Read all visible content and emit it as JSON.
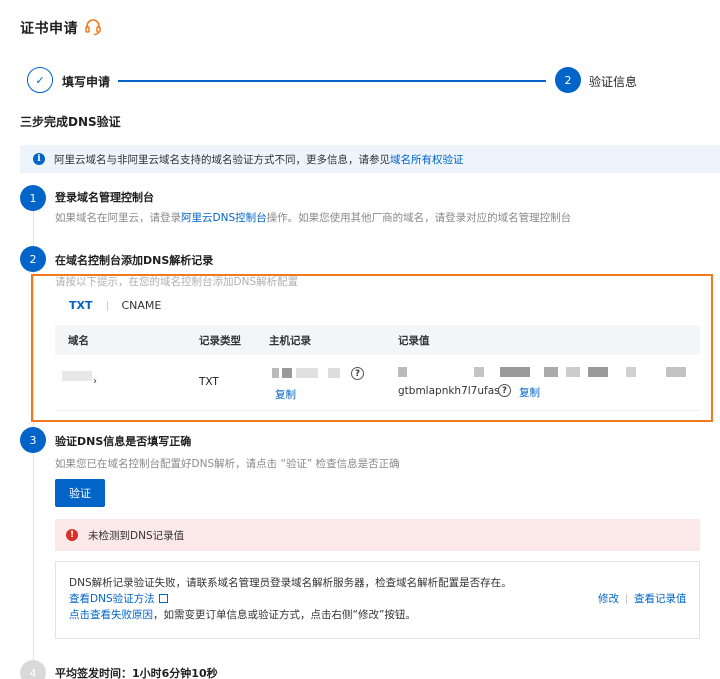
{
  "header": {
    "title": "证书申请"
  },
  "steps": [
    {
      "label": "填写申请",
      "status": "done",
      "mark": "✓"
    },
    {
      "label": "验证信息",
      "number": "2",
      "status": "current"
    }
  ],
  "section_title": "三步完成DNS验证",
  "info": {
    "icon_text": "i",
    "text": "阿里云域名与非阿里云域名支持的域名验证方式不同，更多信息，请参见",
    "link": "域名所有权验证"
  },
  "step1": {
    "number": "1",
    "title": "登录域名管理控制台",
    "desc_prefix": "如果域名在阿里云，请登录",
    "desc_link": "阿里云DNS控制台",
    "desc_suffix": "操作。如果您使用其他厂商的域名，请登录对应的域名管理控制台"
  },
  "step2": {
    "number": "2",
    "title": "在域名控制台添加DNS解析记录",
    "desc": "请按以下提示，在您的域名控制台添加DNS解析配置",
    "tabs": [
      "TXT",
      "CNAME"
    ],
    "columns": [
      "域名",
      "记录类型",
      "主机记录",
      "记录值"
    ],
    "row": {
      "domain": "›",
      "type": "TXT",
      "host_copy": "复制",
      "value_tail": "gtbmlapnkh7l7ufas",
      "value_copy": "复制",
      "help_mark": "?"
    }
  },
  "step3": {
    "number": "3",
    "title": "验证DNS信息是否填写正确",
    "desc": "如果您已在域名控制台配置好DNS解析，请点击 “验证” 检查信息是否正确",
    "verify_button": "验证",
    "error": "未检测到DNS记录值",
    "error_icon": "!",
    "detail_line1": "DNS解析记录验证失败，请联系域名管理员登录域名解析服务器，检查域名解析配置是否存在。",
    "detail_link1": "查看DNS验证方法",
    "detail_link2": "点击查看失败原因",
    "detail_line3_suffix": "，如需变更订单信息或验证方式，点击右侧“修改”按钮。",
    "action_modify": "修改",
    "action_view": "查看记录值"
  },
  "step4": {
    "number": "4",
    "text": "平均签发时间：1小时6分钟10秒"
  },
  "colors": {
    "primary": "#0064c8",
    "highlight": "#f07b1e",
    "error": "#d93026",
    "info_bg": "#eef4fc",
    "error_bg": "#fbe9e9"
  }
}
